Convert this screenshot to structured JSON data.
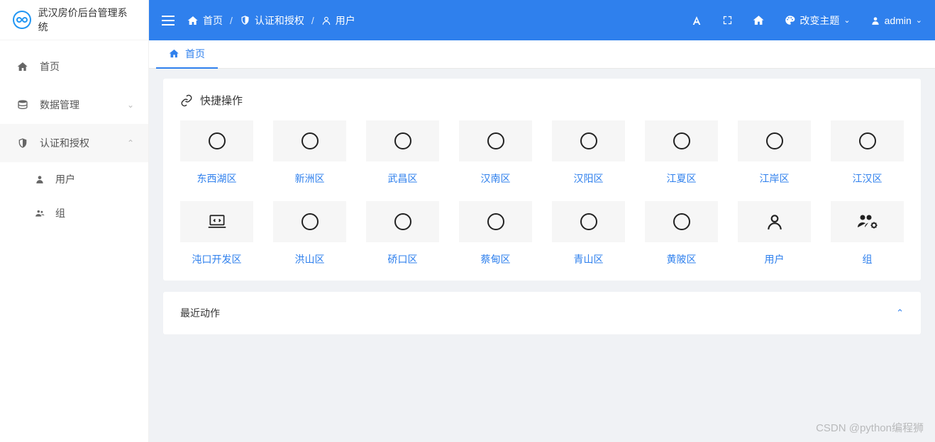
{
  "app": {
    "title": "武汉房价后台管理系统",
    "logo_text": "∞"
  },
  "sidebar": {
    "items": [
      {
        "label": "首页",
        "icon": "home"
      },
      {
        "label": "数据管理",
        "icon": "database"
      },
      {
        "label": "认证和授权",
        "icon": "shield"
      }
    ],
    "submenu": [
      {
        "label": "用户",
        "icon": "user"
      },
      {
        "label": "组",
        "icon": "group"
      }
    ]
  },
  "topbar": {
    "breadcrumb": [
      {
        "label": "首页",
        "icon": "home"
      },
      {
        "label": "认证和授权",
        "icon": "shield"
      },
      {
        "label": "用户",
        "icon": "user"
      }
    ],
    "theme_label": "改变主题",
    "user_label": "admin"
  },
  "tabs": [
    {
      "label": "首页",
      "icon": "home"
    }
  ],
  "quick": {
    "title": "快捷操作",
    "items": [
      {
        "label": "东西湖区",
        "icon": "circle"
      },
      {
        "label": "新洲区",
        "icon": "circle"
      },
      {
        "label": "武昌区",
        "icon": "circle"
      },
      {
        "label": "汉南区",
        "icon": "circle"
      },
      {
        "label": "汉阳区",
        "icon": "circle"
      },
      {
        "label": "江夏区",
        "icon": "circle"
      },
      {
        "label": "江岸区",
        "icon": "circle"
      },
      {
        "label": "江汉区",
        "icon": "circle"
      },
      {
        "label": "沌口开发区",
        "icon": "laptop"
      },
      {
        "label": "洪山区",
        "icon": "circle"
      },
      {
        "label": "硚口区",
        "icon": "circle"
      },
      {
        "label": "蔡甸区",
        "icon": "circle"
      },
      {
        "label": "青山区",
        "icon": "circle"
      },
      {
        "label": "黄陂区",
        "icon": "circle"
      },
      {
        "label": "用户",
        "icon": "user"
      },
      {
        "label": "组",
        "icon": "group-cog"
      }
    ]
  },
  "recent": {
    "title": "最近动作"
  },
  "watermark": "CSDN @python编程狮"
}
